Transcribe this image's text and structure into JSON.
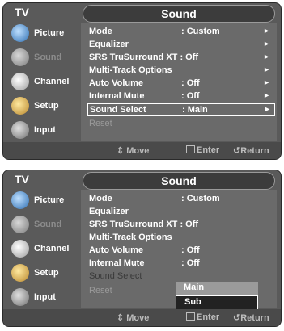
{
  "screen1": {
    "tv_label": "TV",
    "title": "Sound",
    "sidebar": [
      {
        "label": "Picture",
        "icon": "picture-icon"
      },
      {
        "label": "Sound",
        "icon": "sound-icon",
        "state": "dim"
      },
      {
        "label": "Channel",
        "icon": "channel-icon"
      },
      {
        "label": "Setup",
        "icon": "setup-icon"
      },
      {
        "label": "Input",
        "icon": "input-icon"
      }
    ],
    "menu": [
      {
        "label": "Mode",
        "value": ": Custom",
        "arrow": "►"
      },
      {
        "label": "Equalizer",
        "value": "",
        "arrow": "►"
      },
      {
        "label": "SRS TruSurround XT : Off",
        "value": "",
        "arrow": "►"
      },
      {
        "label": "Multi-Track Options",
        "value": "",
        "arrow": "►"
      },
      {
        "label": "Auto Volume",
        "value": ": Off",
        "arrow": "►"
      },
      {
        "label": "Internal Mute",
        "value": ": Off",
        "arrow": "►"
      },
      {
        "label": "Sound Select",
        "value": ": Main",
        "arrow": "►",
        "selected": true
      },
      {
        "label": "Reset",
        "value": "",
        "arrow": "",
        "dim": true
      }
    ],
    "footer": {
      "move": "⇕ Move",
      "enter": "Enter",
      "return": "Return"
    }
  },
  "screen2": {
    "tv_label": "TV",
    "title": "Sound",
    "sidebar": [
      {
        "label": "Picture",
        "icon": "picture-icon"
      },
      {
        "label": "Sound",
        "icon": "sound-icon",
        "state": "dim"
      },
      {
        "label": "Channel",
        "icon": "channel-icon"
      },
      {
        "label": "Setup",
        "icon": "setup-icon"
      },
      {
        "label": "Input",
        "icon": "input-icon"
      }
    ],
    "menu": [
      {
        "label": "Mode",
        "value": ": Custom"
      },
      {
        "label": "Equalizer",
        "value": ""
      },
      {
        "label": "SRS TruSurround XT : Off",
        "value": ""
      },
      {
        "label": "Multi-Track Options",
        "value": ""
      },
      {
        "label": "Auto Volume",
        "value": ": Off"
      },
      {
        "label": "Internal Mute",
        "value": ": Off"
      },
      {
        "label": "Sound Select",
        "value": "",
        "dimlabel": true
      },
      {
        "label": "Reset",
        "value": "",
        "dim": true
      }
    ],
    "dropdown": {
      "options": [
        "Main",
        "Sub"
      ],
      "selected": "Sub"
    },
    "footer": {
      "move": "⇕ Move",
      "enter": "Enter",
      "return": "Return"
    }
  }
}
